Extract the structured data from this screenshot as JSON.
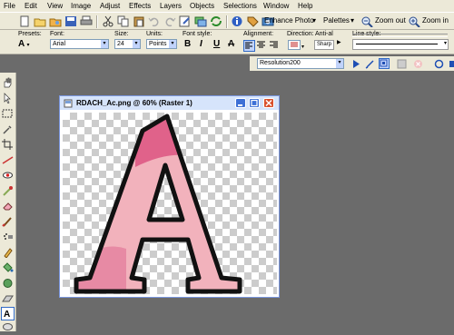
{
  "menu": [
    "File",
    "Edit",
    "View",
    "Image",
    "Adjust",
    "Effects",
    "Layers",
    "Objects",
    "Selections",
    "Window",
    "Help"
  ],
  "toolbar": {
    "enhance_photo": "Enhance Photo",
    "palettes": "Palettes",
    "zoom_out": "Zoom out",
    "zoom_in": "Zoom in"
  },
  "text_options": {
    "presets_label": "Presets:",
    "font_label": "Font:",
    "font_value": "Arial",
    "size_label": "Size:",
    "size_value": "24",
    "units_label": "Units:",
    "units_value": "Points",
    "font_style_label": "Font style:",
    "bold": "B",
    "italic": "I",
    "underline": "U",
    "strikethrough": "A",
    "alignment_label": "Alignment:",
    "direction_label": "Direction:",
    "antialias_label": "Anti-al",
    "antialias_value": "Sharp",
    "line_style_label": "Line style:"
  },
  "script": {
    "selected": "Resolution200"
  },
  "document": {
    "title": "RDACH_Ac.png @  60% (Raster 1)",
    "letter": "A"
  },
  "colors": {
    "letter_outline": "#111111",
    "letter_fill": "#f2b2bc",
    "letter_accent": "#e0628a",
    "checker": "#cccccc"
  }
}
